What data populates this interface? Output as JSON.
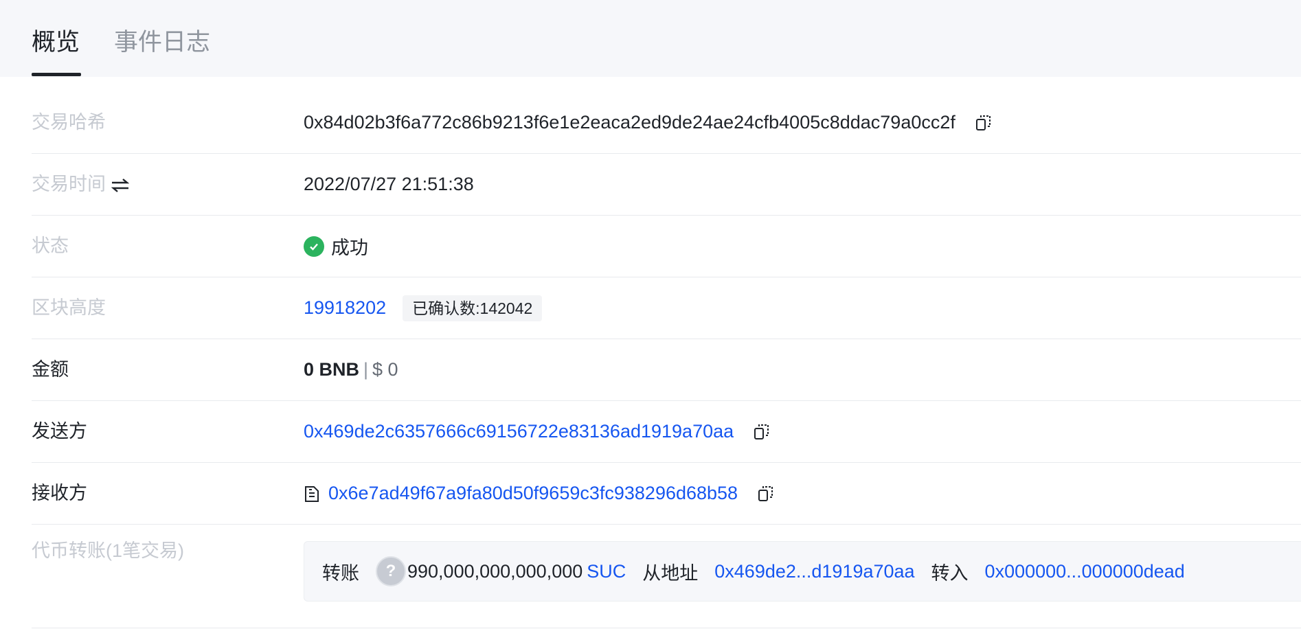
{
  "tabs": [
    {
      "label": "概览",
      "active": true
    },
    {
      "label": "事件日志",
      "active": false
    }
  ],
  "rows": {
    "tx_hash": {
      "label": "交易哈希",
      "value": "0x84d02b3f6a772c86b9213f6e1e2eaca2ed9de24ae24cfb4005c8ddac79a0cc2f"
    },
    "tx_time": {
      "label": "交易时间",
      "value": "2022/07/27 21:51:38"
    },
    "status": {
      "label": "状态",
      "value": "成功",
      "color": "#2bb35e"
    },
    "block": {
      "label": "区块高度",
      "value": "19918202",
      "confirm_label": "已确认数:",
      "confirm_value": "142042"
    },
    "amount": {
      "label": "金额",
      "value": "0 BNB",
      "separator": "|",
      "usd": "$ 0"
    },
    "sender": {
      "label": "发送方",
      "value": "0x469de2c6357666c69156722e83136ad1919a70aa"
    },
    "receiver": {
      "label": "接收方",
      "value": "0x6e7ad49f67a9fa80d50f9659c3fc938296d68b58"
    },
    "token_transfer": {
      "label": "代币转账(1笔交易)",
      "action": "转账",
      "amount": "990,000,000,000,000",
      "token": "SUC",
      "from_label": "从地址",
      "from": "0x469de2...d1919a70aa",
      "to_label": "转入",
      "to": "0x000000...000000dead"
    }
  },
  "colors": {
    "link": "#1656f0",
    "muted_label": "#c6cad1",
    "tab_bg": "#f6f7fa"
  }
}
